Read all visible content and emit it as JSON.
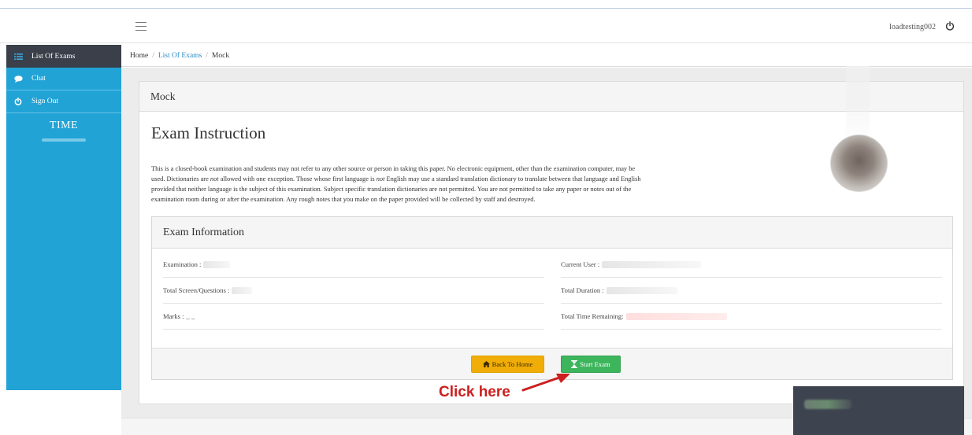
{
  "topbar": {
    "username": "loadtesting002"
  },
  "sidebar": {
    "items": [
      {
        "label": "List Of Exams",
        "icon": "list-icon"
      },
      {
        "label": "Chat",
        "icon": "chat-icon"
      },
      {
        "label": "Sign Out",
        "icon": "power-icon"
      }
    ],
    "time_label": "TIME"
  },
  "breadcrumb": {
    "home": "Home",
    "list": "List Of Exams",
    "current": "Mock"
  },
  "panel": {
    "title": "Mock",
    "heading": "Exam Instruction",
    "instructions": [
      "This is a closed-book examination and students may not refer to any other source or person in taking this paper. No electronic equipment, other than the examination computer, may be",
      "used. Dictionaries are ",
      "not",
      " allowed with one exception. Those whose first language is ",
      "not",
      " English may use a standard translation dictionary to translate between that language and English",
      "provided that neither language is the subject of this examination. Subject specific translation dictionaries are not permitted. You are not permitted to take any paper or notes out of the",
      "examination room during or after the examination. Any rough notes that you make on the paper provided will be collected by staff and destroyed."
    ]
  },
  "exam_info": {
    "title": "Exam Information",
    "examination_label": "Examination :",
    "total_screen_label": "Total Screen/Questions :",
    "marks_label": "Marks :",
    "marks_value": "_ _",
    "current_user_label": "Current User :",
    "total_duration_label": "Total Duration :",
    "time_remaining_label": "Total Time Remaining:"
  },
  "buttons": {
    "back_home": "Back To Home",
    "start_exam": "Start Exam"
  },
  "annotation": {
    "click_here": "Click here",
    "color": "#cc1f1f"
  },
  "colors": {
    "sidebar": "#21a3d6",
    "sidebar_active": "#3a3f4a",
    "back_button": "#f0ad08",
    "start_button": "#3db55c"
  }
}
